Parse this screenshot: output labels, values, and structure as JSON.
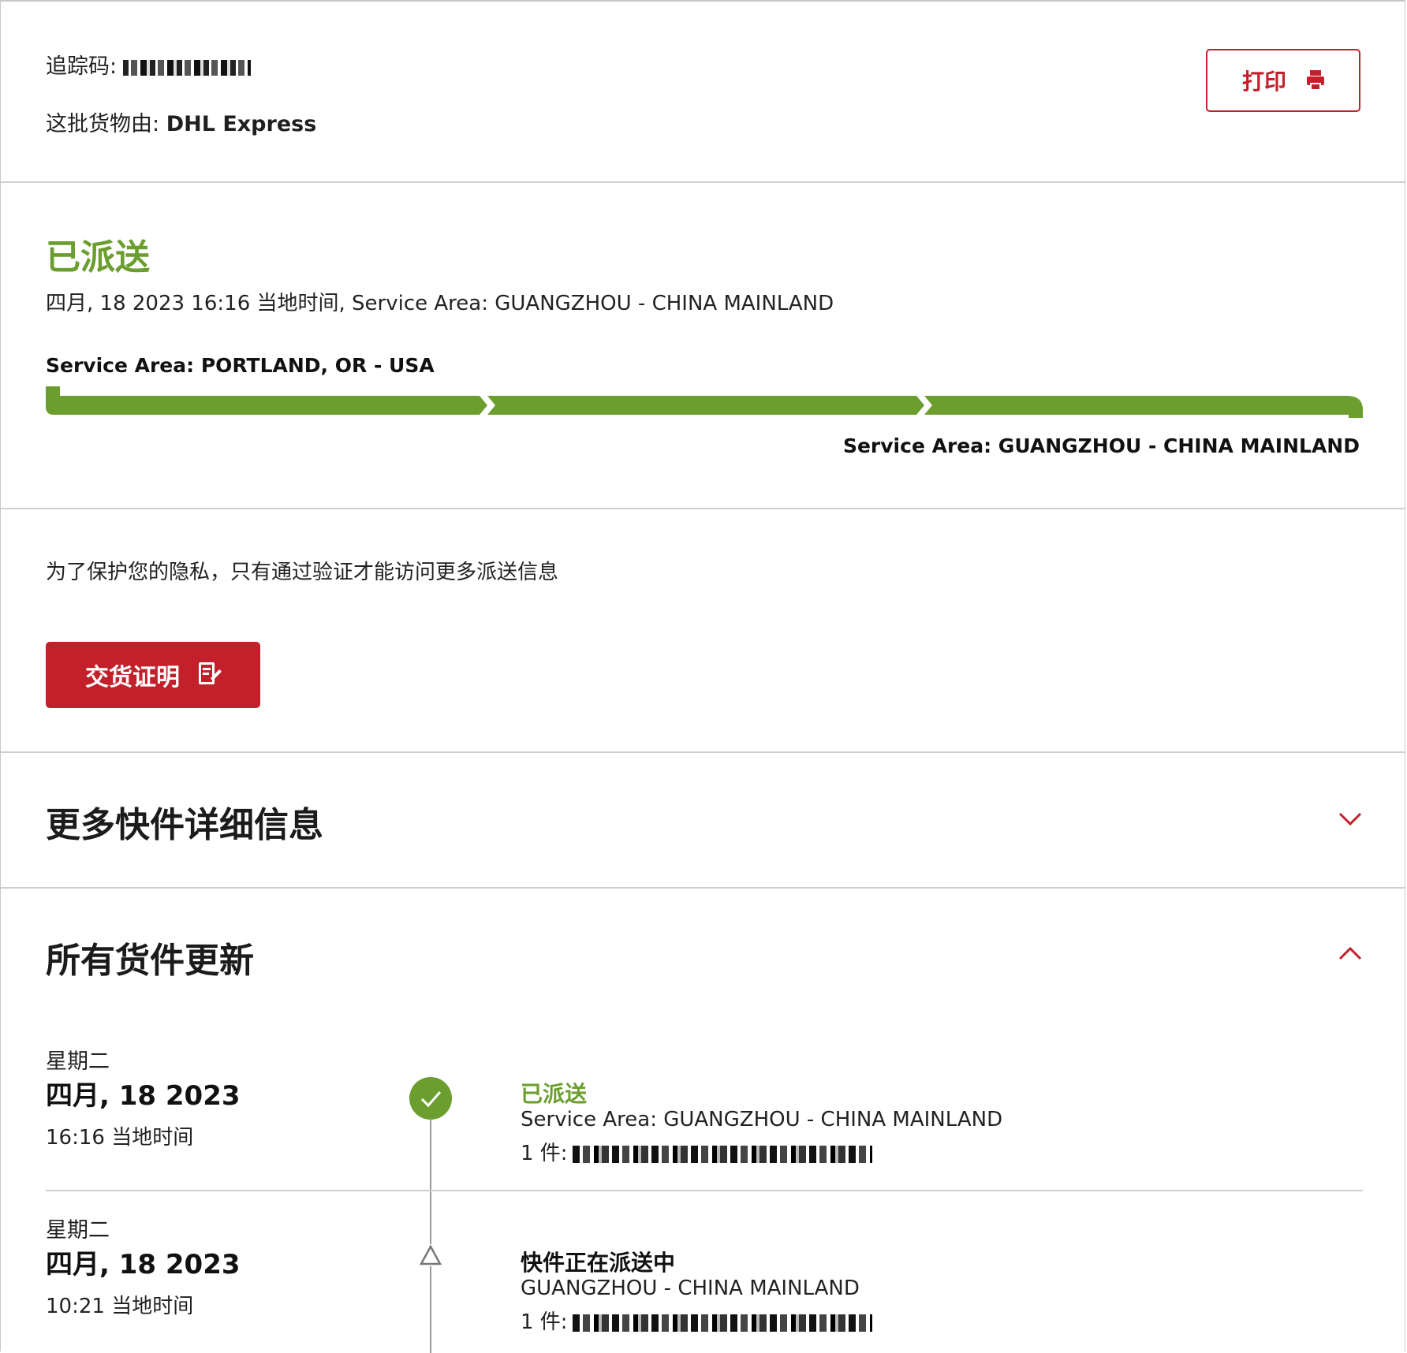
{
  "header": {
    "tracking_label": "追踪码:",
    "carrier_label": "这批货物由:",
    "carrier_name": "DHL Express",
    "print_label": "打印"
  },
  "status": {
    "title": "已派送",
    "subtitle": "四月, 18 2023 16:16 当地时间, Service Area: GUANGZHOU - CHINA MAINLAND",
    "origin": "Service Area: PORTLAND, OR - USA",
    "destination": "Service Area: GUANGZHOU - CHINA MAINLAND",
    "progress": 1.0
  },
  "privacy": {
    "message": "为了保护您的隐私，只有通过验证才能访问更多派送信息",
    "pod_button": "交货证明"
  },
  "more_details": {
    "title": "更多快件详细信息"
  },
  "updates": {
    "title": "所有货件更新",
    "events": [
      {
        "day": "星期二",
        "date": "四月, 18 2023",
        "time": "16:16 当地时间",
        "title": "已派送",
        "location": "Service Area: GUANGZHOU - CHINA MAINLAND",
        "piece_label": "1 件:"
      },
      {
        "day": "星期二",
        "date": "四月, 18 2023",
        "time": "10:21 当地时间",
        "title": "快件正在派送中",
        "location": "GUANGZHOU - CHINA MAINLAND",
        "piece_label": "1 件:"
      }
    ]
  },
  "colors": {
    "brand_red": "#c2202a",
    "delivered_green": "#6b9e2f"
  }
}
